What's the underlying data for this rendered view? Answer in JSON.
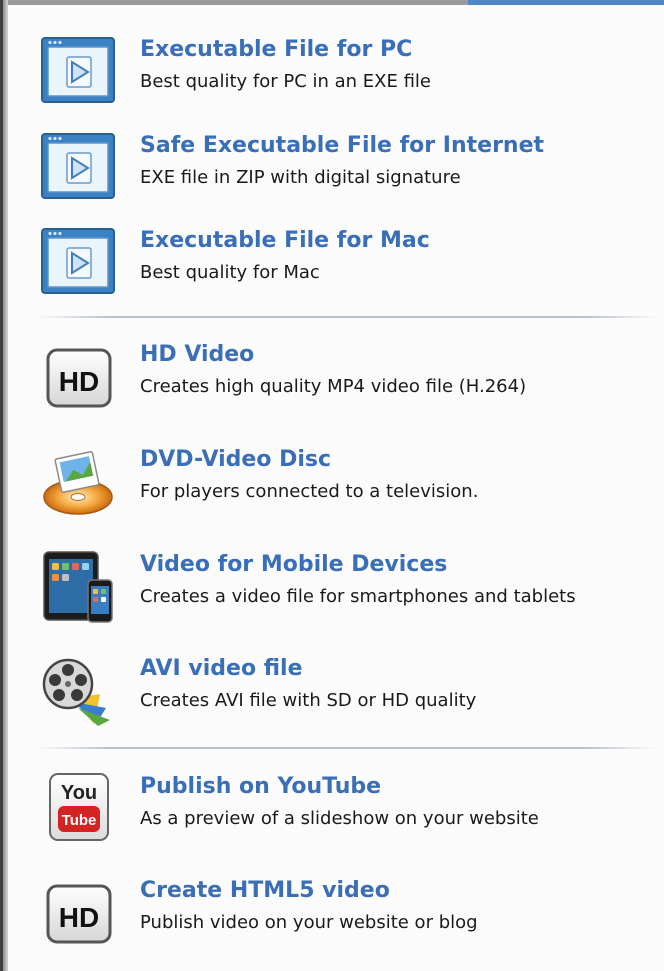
{
  "menu": {
    "items": [
      {
        "id": "exe-pc",
        "icon": "executable-window-icon",
        "title": "Executable File for PC",
        "desc": "Best quality for PC in an EXE file"
      },
      {
        "id": "exe-internet",
        "icon": "executable-window-icon",
        "title": "Safe Executable File for Internet",
        "desc": "EXE file in ZIP with digital signature"
      },
      {
        "id": "exe-mac",
        "icon": "executable-window-icon",
        "title": "Executable File for Mac",
        "desc": "Best quality for Mac"
      },
      {
        "id": "hd-video",
        "icon": "hd-icon",
        "title": "HD Video",
        "desc": "Creates high quality MP4 video file (H.264)"
      },
      {
        "id": "dvd",
        "icon": "dvd-disc-icon",
        "title": "DVD-Video Disc",
        "desc": "For players connected to a television."
      },
      {
        "id": "mobile",
        "icon": "mobile-devices-icon",
        "title": "Video for Mobile Devices",
        "desc": "Creates a video file for smartphones and tablets"
      },
      {
        "id": "avi",
        "icon": "film-reel-icon",
        "title": "AVI video file",
        "desc": "Creates AVI file with SD or HD quality"
      },
      {
        "id": "youtube",
        "icon": "youtube-icon",
        "title": "Publish on YouTube",
        "desc": "As a preview of a slideshow on your website"
      },
      {
        "id": "html5",
        "icon": "hd-icon",
        "title": "Create HTML5 video",
        "desc": "Publish video on your website or blog"
      }
    ]
  },
  "icons": {
    "hd_text": "HD",
    "youtube_you": "You",
    "youtube_tube": "Tube"
  },
  "colors": {
    "title": "#3a6fb8",
    "description": "#1a1a1a",
    "background": "#fbfbfb",
    "accent": "#4f86c7"
  }
}
